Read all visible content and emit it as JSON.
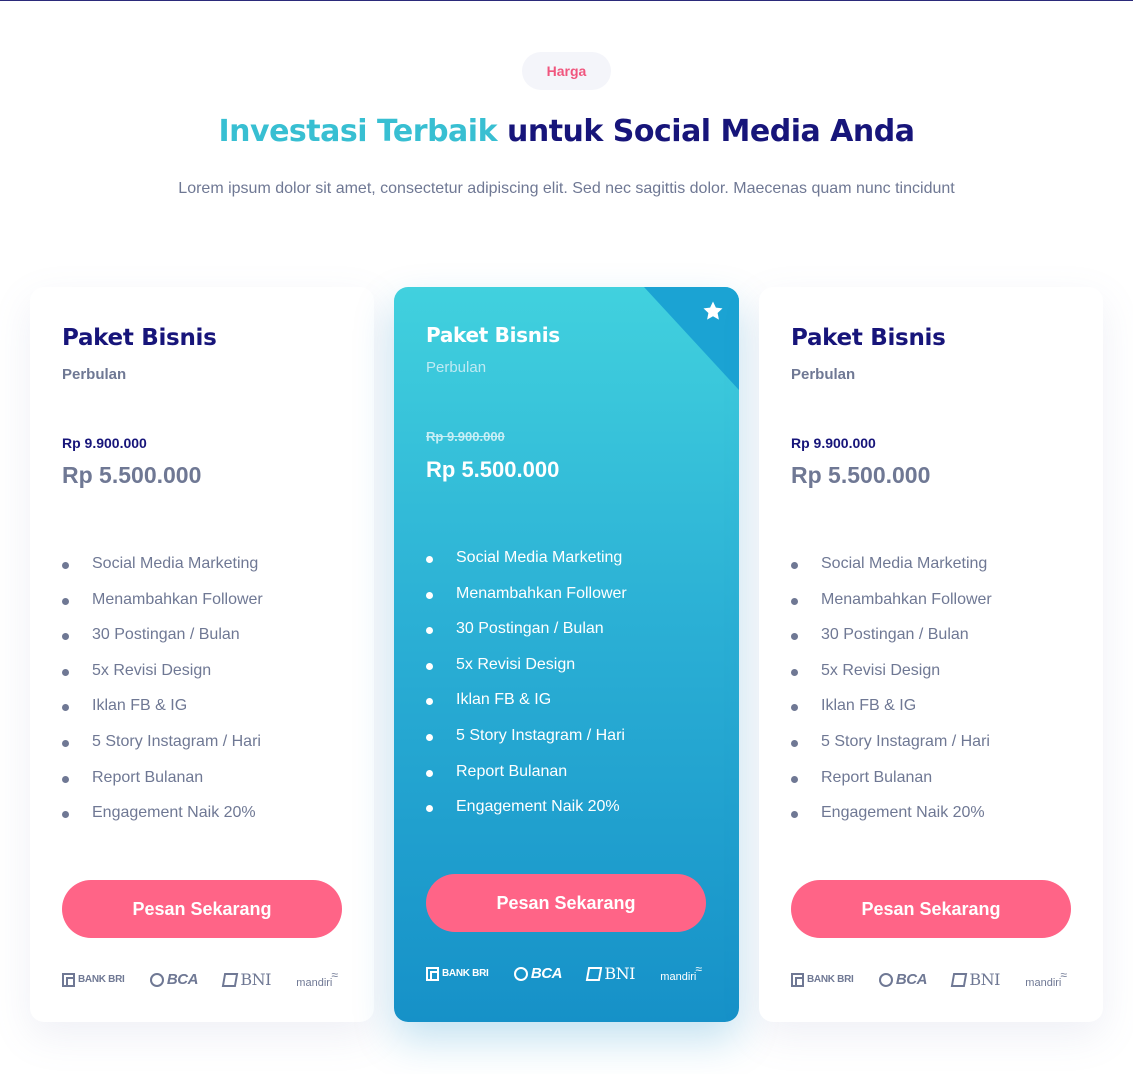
{
  "header": {
    "badge": "Harga",
    "title_accent": "Investasi Terbaik",
    "title_rest": " untuk Social Media Anda",
    "subtitle": "Lorem ipsum dolor sit amet, consectetur adipiscing elit. Sed nec sagittis dolor. Maecenas quam nunc tincidunt"
  },
  "cards": [
    {
      "name": "Paket Bisnis",
      "period": "Perbulan",
      "old_price": "Rp 9.900.000",
      "price": "Rp 5.500.000",
      "features": [
        "Social Media Marketing",
        "Menambahkan Follower",
        "30 Postingan / Bulan",
        "5x Revisi Design",
        "Iklan FB & IG",
        "5 Story Instagram / Hari",
        "Report Bulanan",
        "Engagement Naik 20%"
      ],
      "button": "Pesan Sekarang"
    },
    {
      "name": "Paket Bisnis",
      "period": "Perbulan",
      "old_price": "Rp 9.900.000",
      "price": "Rp 5.500.000",
      "features": [
        "Social Media Marketing",
        "Menambahkan Follower",
        "30 Postingan / Bulan",
        "5x Revisi Design",
        "Iklan FB & IG",
        "5 Story Instagram / Hari",
        "Report Bulanan",
        "Engagement Naik 20%"
      ],
      "button": "Pesan Sekarang",
      "featured_icon": "star-icon"
    },
    {
      "name": "Paket Bisnis",
      "period": "Perbulan",
      "old_price": "Rp 9.900.000",
      "price": "Rp 5.500.000",
      "features": [
        "Social Media Marketing",
        "Menambahkan Follower",
        "30 Postingan / Bulan",
        "5x Revisi Design",
        "Iklan FB & IG",
        "5 Story Instagram / Hari",
        "Report Bulanan",
        "Engagement Naik 20%"
      ],
      "button": "Pesan Sekarang"
    }
  ],
  "banks": {
    "bri": "BANK BRI",
    "bca": "BCA",
    "bni": "BNI",
    "mandiri": "mandiri"
  },
  "colors": {
    "brand_navy": "#17157a",
    "accent_cyan": "#38bfd2",
    "badge_pink": "#f0567e",
    "button_pink": "#ff6487",
    "text_gray": "#6f7894"
  }
}
